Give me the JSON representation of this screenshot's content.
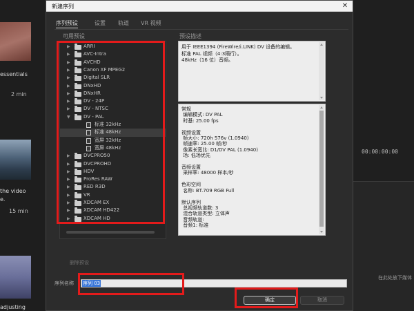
{
  "background": {
    "left_texts": [
      " essentials",
      "2 min",
      " the video",
      "e.",
      "15 min",
      "adjusting"
    ],
    "timecode": "00:00:00:00",
    "hint": "在此处放下媒体"
  },
  "dialog": {
    "title": "新建序列",
    "tabs": [
      {
        "label": "序列预设"
      },
      {
        "label": "设置"
      },
      {
        "label": "轨道"
      },
      {
        "label": "VR 视频"
      }
    ],
    "available_presets_label": "可用预设",
    "preset_description_label": "预设描述",
    "presets": [
      {
        "label": "ARRI",
        "type": "folder",
        "expanded": false
      },
      {
        "label": "AVC-Intra",
        "type": "folder",
        "expanded": false
      },
      {
        "label": "AVCHD",
        "type": "folder",
        "expanded": false
      },
      {
        "label": "Canon XF MPEG2",
        "type": "folder",
        "expanded": false
      },
      {
        "label": "Digital SLR",
        "type": "folder",
        "expanded": false
      },
      {
        "label": "DNxHD",
        "type": "folder",
        "expanded": false
      },
      {
        "label": "DNxHR",
        "type": "folder",
        "expanded": false
      },
      {
        "label": "DV - 24P",
        "type": "folder",
        "expanded": false
      },
      {
        "label": "DV - NTSC",
        "type": "folder",
        "expanded": false
      },
      {
        "label": "DV - PAL",
        "type": "folder",
        "expanded": true
      },
      {
        "label": "标准 32kHz",
        "type": "file",
        "child": true
      },
      {
        "label": "标准 48kHz",
        "type": "file",
        "child": true,
        "selected": true
      },
      {
        "label": "宽屏 32kHz",
        "type": "file",
        "child": true
      },
      {
        "label": "宽屏 48kHz",
        "type": "file",
        "child": true
      },
      {
        "label": "DVCPRO50",
        "type": "folder",
        "expanded": false
      },
      {
        "label": "DVCPROHD",
        "type": "folder",
        "expanded": false
      },
      {
        "label": "HDV",
        "type": "folder",
        "expanded": false
      },
      {
        "label": "ProRes RAW",
        "type": "folder",
        "expanded": false
      },
      {
        "label": "RED R3D",
        "type": "folder",
        "expanded": false
      },
      {
        "label": "VR",
        "type": "folder",
        "expanded": false
      },
      {
        "label": "XDCAM EX",
        "type": "folder",
        "expanded": false
      },
      {
        "label": "XDCAM HD422",
        "type": "folder",
        "expanded": false
      },
      {
        "label": "XDCAM HD",
        "type": "folder",
        "expanded": false
      }
    ],
    "description": "用于 IEEE1394 (FireWire/i.LINK) DV 设备的编辑。\n标准 PAL 视频（4:3隔行）。\n48kHz（16 位）音频。",
    "info": "常规\n 编辑模式: DV PAL\n 时基: 25.00 fps\n\n视频设置\n 帧大小: 720h 576v (1.0940)\n 帧速率: 25.00 帧/秒\n 像素长宽比: D1/DV PAL (1.0940)\n 场: 低场优先\n\n音频设置\n 采样率: 48000 样本/秒\n\n色彩空间\n 名称: BT.709 RGB Full\n\n默认序列\n 总视频轨道数: 3\n 混合轨道类型: 立体声\n 音频轨道:\n 音频1: 标准",
    "delete_preset": "删除预设",
    "sequence_name_label": "序列名称",
    "sequence_name_value": "序列 03",
    "ok": "确定",
    "cancel": "取消",
    "close_glyph": "✕"
  },
  "colors": {
    "highlight": "#e31b1b",
    "selection": "#3a77d8"
  }
}
